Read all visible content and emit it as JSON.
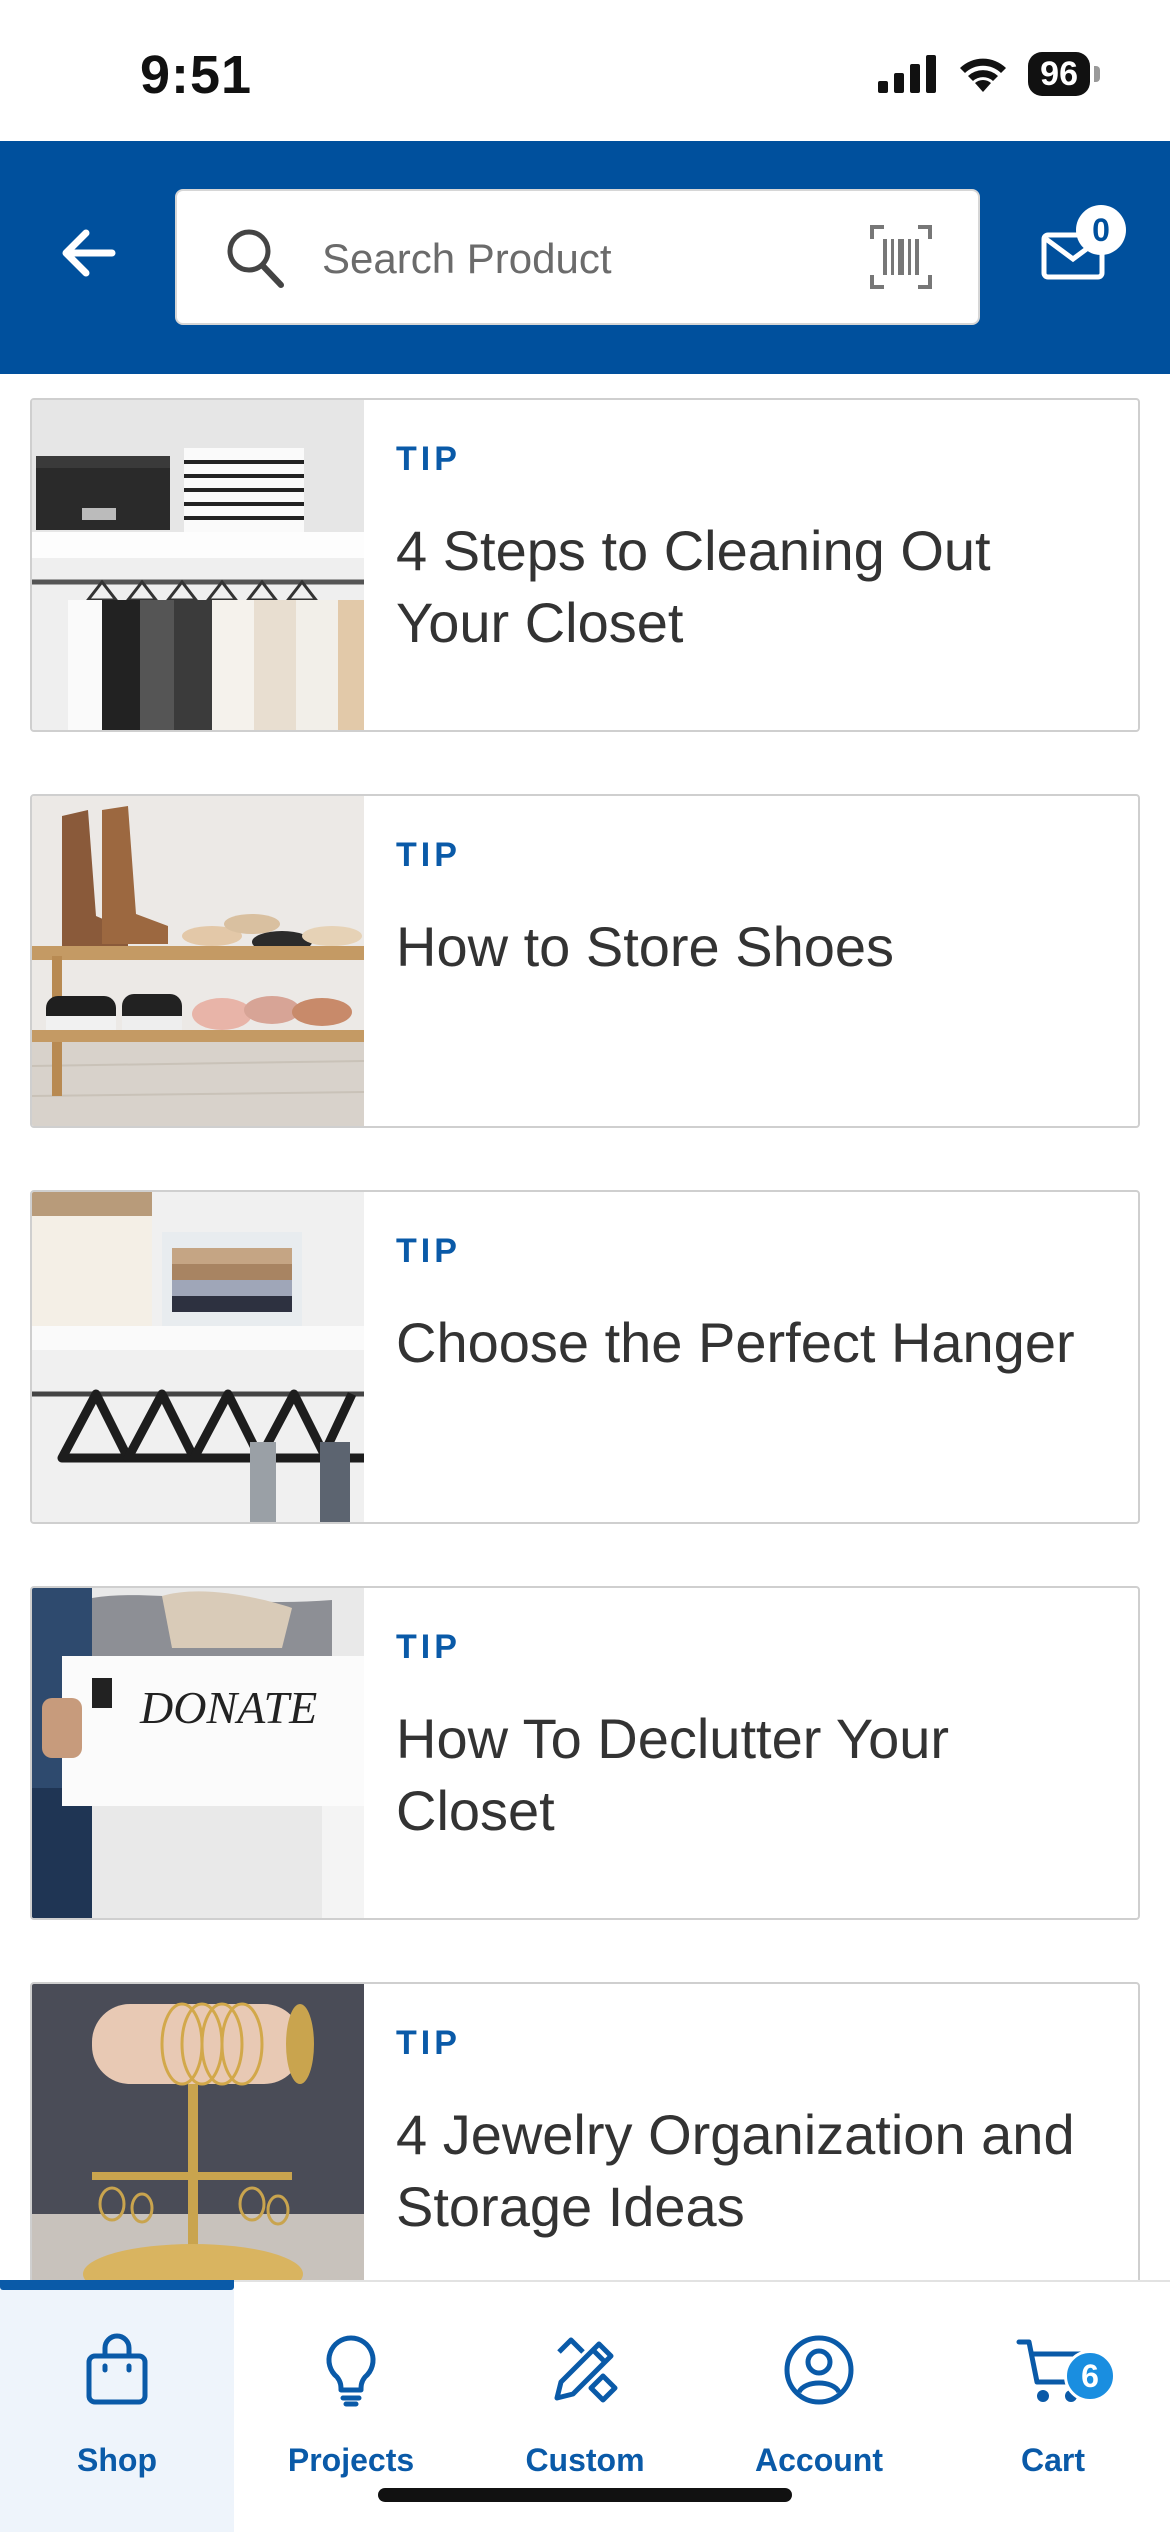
{
  "status_bar": {
    "time": "9:51",
    "battery": "96"
  },
  "header": {
    "search_placeholder": "Search Product",
    "mail_count": "0",
    "colors": {
      "background": "#00509d"
    }
  },
  "cards": [
    {
      "tag": "TIP",
      "title": "4 Steps to Cleaning Out Your Closet",
      "image": "closet-shelves-hangers"
    },
    {
      "tag": "TIP",
      "title": "How to Store Shoes",
      "image": "shoe-rack"
    },
    {
      "tag": "TIP",
      "title": "Choose the Perfect Hanger",
      "image": "hangers-on-rod"
    },
    {
      "tag": "TIP",
      "title": "How To Declutter Your Closet",
      "image": "donate-box",
      "image_text": "DONATE"
    },
    {
      "tag": "TIP",
      "title": "4 Jewelry Organization and Storage Ideas",
      "image": "jewelry-stand"
    }
  ],
  "tabbar": {
    "tabs": [
      {
        "label": "Shop",
        "icon": "shopping-bag-icon",
        "active": true
      },
      {
        "label": "Projects",
        "icon": "lightbulb-icon",
        "active": false
      },
      {
        "label": "Custom",
        "icon": "pencil-ruler-icon",
        "active": false
      },
      {
        "label": "Account",
        "icon": "user-circle-icon",
        "active": false
      },
      {
        "label": "Cart",
        "icon": "cart-icon",
        "active": false
      }
    ],
    "cart_count": "6",
    "accent": "#0a5aa8"
  }
}
